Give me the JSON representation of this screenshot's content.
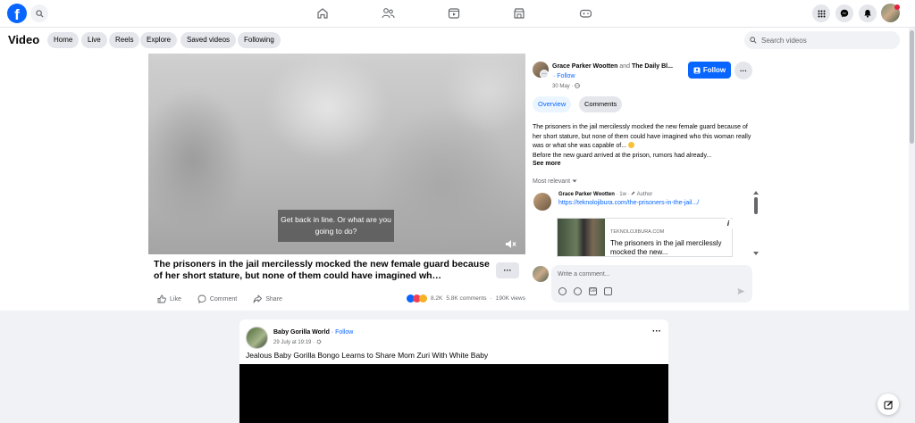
{
  "topnav": {
    "logo_letter": "f",
    "icons": [
      "home-icon",
      "friends-icon",
      "video-icon",
      "marketplace-icon",
      "gaming-icon"
    ],
    "right_icons": [
      "menu-grid-icon",
      "messenger-icon",
      "bell-icon"
    ]
  },
  "header": {
    "title": "Video",
    "pills": [
      "Home",
      "Live",
      "Reels",
      "Explore",
      "Saved videos",
      "Following"
    ],
    "search_placeholder": "Search videos"
  },
  "video": {
    "caption": "Get back in line. Or what are you going to do?",
    "post_title": "The prisoners in the jail mercilessly mocked the new female guard because of her short stature, but none of them could have imagined wh…",
    "more": "···",
    "actions": {
      "like": "Like",
      "comment": "Comment",
      "share": "Share"
    },
    "stats": {
      "reactions": "8.2K",
      "comments": "5.8K comments",
      "views": "190K views"
    }
  },
  "sidebar": {
    "author_name": "Grace Parker Wootten",
    "author_and": "and",
    "coauthor": "The Daily Bl...",
    "follow_link": "· Follow",
    "date": "30 May ·",
    "follow_button": "Follow",
    "dots": "···",
    "tabs": [
      "Overview",
      "Comments"
    ],
    "description_1": "The prisoners in the jail mercilessly mocked the new female guard because of her short stature, but none of them could have imagined who this woman really was or what she was capable of...",
    "description_2": "Before the new guard arrived at the prison, rumors had already...",
    "see_more": "See more",
    "most_relevant": "Most relevant",
    "comment": {
      "name": "Grace Parker Wootten",
      "meta": "· 1w ·",
      "badge": "Author",
      "link": "https://teknolojibura.com/the-prisoners-in-the-jail.../",
      "card_domain": "TEKNOLOJIBURA.COM",
      "card_title": "The prisoners in the jail mercilessly mocked the new..."
    },
    "write_placeholder": "Write a comment..."
  },
  "post2": {
    "name": "Baby Gorilla World",
    "follow": "· Follow",
    "date": "29 July at 19:19 ·",
    "dots": "···",
    "text": "Jealous Baby Gorilla Bongo Learns to Share Mom Zuri With White Baby"
  },
  "colors": {
    "brand_blue": "#0866ff",
    "page_bg": "#f0f2f5",
    "panel_bg": "#ffffff"
  }
}
